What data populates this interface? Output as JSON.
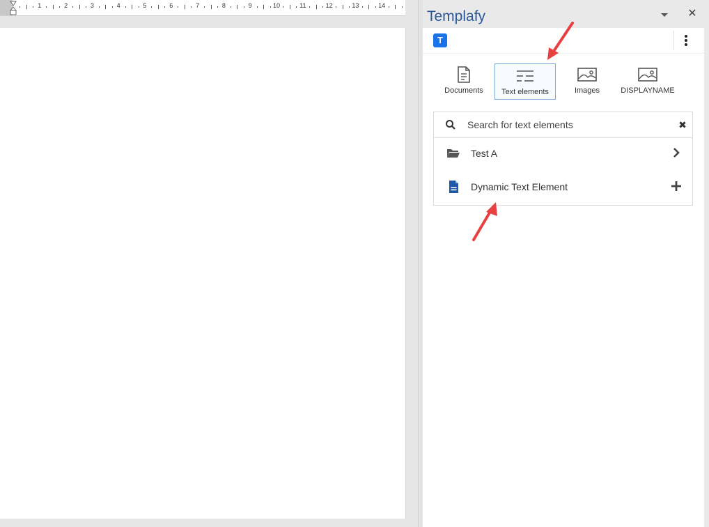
{
  "pane": {
    "title": "Templafy",
    "logo_letter": "T",
    "tabs": [
      {
        "label": "Documents",
        "icon": "document-icon"
      },
      {
        "label": "Text elements",
        "icon": "text-elements-icon",
        "active": true
      },
      {
        "label": "Images",
        "icon": "image-icon"
      },
      {
        "label": "DISPLAYNAME",
        "icon": "image-icon"
      }
    ],
    "search": {
      "placeholder": "Search for text elements",
      "value": ""
    },
    "items": [
      {
        "label": "Test A",
        "icon": "folder-open-icon",
        "action": "chevron-right-icon"
      },
      {
        "label": "Dynamic Text Element",
        "icon": "text-document-icon",
        "action": "plus-icon"
      }
    ]
  },
  "ruler": {
    "numbers": [
      "1",
      "2",
      "3",
      "4",
      "5",
      "6",
      "7",
      "8",
      "9",
      "10",
      "11",
      "12",
      "13",
      "14"
    ]
  },
  "colors": {
    "accent": "#2b579a",
    "logo": "#1a73e8",
    "annotation_arrow": "#e84040",
    "doc_icon": "#1f5aa8"
  }
}
